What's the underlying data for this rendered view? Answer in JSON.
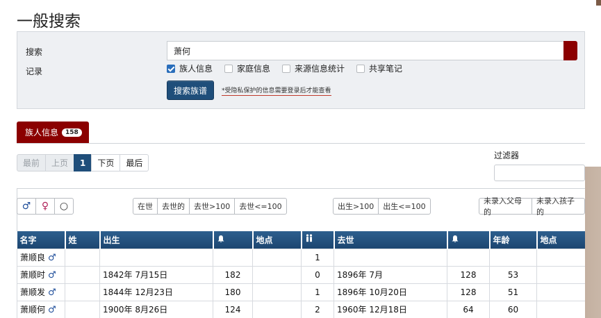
{
  "page": {
    "title": "一般搜索"
  },
  "search": {
    "label": "搜索",
    "value": "萧何",
    "records_label": "记录",
    "options": [
      {
        "label": "族人信息",
        "checked": true
      },
      {
        "label": "家庭信息",
        "checked": false
      },
      {
        "label": "来源信息统计",
        "checked": false
      },
      {
        "label": "共享笔记",
        "checked": false
      }
    ],
    "submit_label": "搜索族谱",
    "note": "*受隐私保护的信息需要登录后才能查看"
  },
  "tab": {
    "label": "族人信息",
    "count": "158"
  },
  "pager": {
    "first": "最前",
    "prev": "上页",
    "current": "1",
    "next": "下页",
    "last": "最后"
  },
  "filter": {
    "label": "过滤器",
    "value": ""
  },
  "sex_filters": {
    "male": "♂",
    "female": "♀",
    "unknown": "○"
  },
  "status_filters": [
    "在世",
    "去世的",
    "去世>100",
    "去世<=100"
  ],
  "birth_filters": [
    "出生>100",
    "出生<=100"
  ],
  "link_filters": [
    "未录入父母的",
    "未录入孩子的"
  ],
  "table": {
    "headers": {
      "given": "名字",
      "surname": "姓",
      "birth": "出生",
      "birth_age": "",
      "birth_place": "地点",
      "children": "",
      "death": "去世",
      "death_age": "",
      "age": "年龄",
      "death_place": "地点"
    },
    "rows": [
      {
        "given": "萧顺良",
        "sex": "♂",
        "surname": "",
        "birth": "",
        "birth_age": "",
        "birth_place": "",
        "children": "1",
        "death": "",
        "death_age": "",
        "age": "",
        "death_place": ""
      },
      {
        "given": "萧顺时",
        "sex": "♂",
        "surname": "",
        "birth": "1842年 7月15日",
        "birth_age": "182",
        "birth_place": "",
        "children": "0",
        "death": "1896年 7月",
        "death_age": "128",
        "age": "53",
        "death_place": ""
      },
      {
        "given": "萧顺发",
        "sex": "♂",
        "surname": "",
        "birth": "1844年 12月23日",
        "birth_age": "180",
        "birth_place": "",
        "children": "1",
        "death": "1896年 10月20日",
        "death_age": "128",
        "age": "51",
        "death_place": ""
      },
      {
        "given": "萧顺何",
        "sex": "♂",
        "surname": "",
        "birth": "1900年 8月26日",
        "birth_age": "124",
        "birth_place": "",
        "children": "2",
        "death": "1960年 12月18日",
        "death_age": "64",
        "age": "60",
        "death_place": ""
      }
    ]
  }
}
